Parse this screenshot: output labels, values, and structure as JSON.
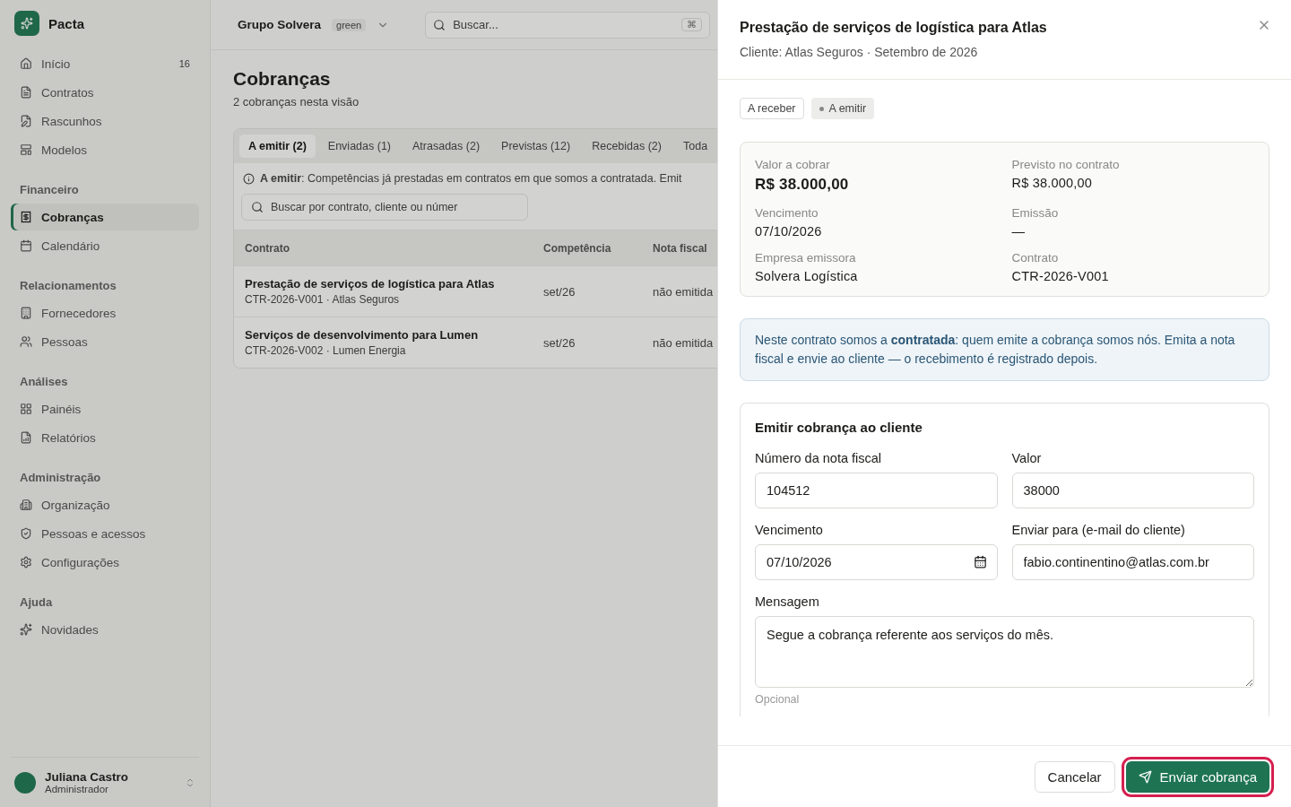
{
  "sidebar": {
    "brand": "Pacta",
    "sections": [
      {
        "items": [
          {
            "label": "Início",
            "badge": "16",
            "selected": false
          },
          {
            "label": "Contratos",
            "selected": false
          },
          {
            "label": "Rascunhos",
            "selected": false
          },
          {
            "label": "Modelos",
            "selected": false
          }
        ]
      },
      {
        "title": "Financeiro",
        "items": [
          {
            "label": "Cobranças",
            "selected": true
          },
          {
            "label": "Calendário",
            "selected": false
          }
        ]
      },
      {
        "title": "Relacionamentos",
        "items": [
          {
            "label": "Fornecedores",
            "selected": false
          },
          {
            "label": "Pessoas",
            "selected": false
          }
        ]
      },
      {
        "title": "Análises",
        "items": [
          {
            "label": "Painéis",
            "selected": false
          },
          {
            "label": "Relatórios",
            "selected": false
          }
        ]
      },
      {
        "title": "Administração",
        "items": [
          {
            "label": "Organização",
            "selected": false
          },
          {
            "label": "Pessoas e acessos",
            "selected": false
          },
          {
            "label": "Configurações",
            "selected": false
          }
        ]
      },
      {
        "title": "Ajuda",
        "items": [
          {
            "label": "Novidades",
            "selected": false
          }
        ]
      }
    ],
    "user": {
      "name": "Juliana Castro",
      "role": "Administrador"
    }
  },
  "topbar": {
    "org": "Grupo Solvera",
    "org_tag": "green",
    "search_placeholder": "Buscar...",
    "shortcut": "⌘"
  },
  "page": {
    "title": "Cobranças",
    "subtitle": "2 cobranças nesta visão",
    "tabs": [
      {
        "label": "A emitir (2)",
        "selected": true
      },
      {
        "label": "Enviadas (1)",
        "selected": false
      },
      {
        "label": "Atrasadas (2)",
        "selected": false
      },
      {
        "label": "Previstas (12)",
        "selected": false
      },
      {
        "label": "Recebidas (2)",
        "selected": false
      },
      {
        "label": "Toda",
        "selected": false
      }
    ],
    "info": "**A emitir**: Competências já prestadas em contratos em que somos a contratada. Emit",
    "filter_placeholder": "Buscar por contrato, cliente ou númer",
    "table": {
      "columns": [
        "Contrato",
        "Competência",
        "Nota fiscal"
      ],
      "rows": [
        {
          "title": "Prestação de serviços de logística para Atlas",
          "sub": "CTR-2026-V001 · Atlas Seguros",
          "period": "set/26",
          "invoice": "não emitida"
        },
        {
          "title": "Serviços de desenvolvimento para Lumen",
          "sub": "CTR-2026-V002 · Lumen Energia",
          "period": "set/26",
          "invoice": "não emitida"
        }
      ]
    }
  },
  "drawer": {
    "title": "Prestação de serviços de logística para Atlas",
    "subtitle": "Cliente: Atlas Seguros · Setembro de 2026",
    "badges": [
      {
        "label": "A receber",
        "kind": "outline"
      },
      {
        "label": "A emitir",
        "kind": "dot"
      }
    ],
    "details": [
      {
        "label": "Valor a cobrar",
        "value": "R$ 38.000,00",
        "emphasis": true
      },
      {
        "label": "Previsto no contrato",
        "value": "R$ 38.000,00",
        "emphasis": false
      },
      {
        "label": "Vencimento",
        "value": "07/10/2026",
        "emphasis": false
      },
      {
        "label": "Emissão",
        "value": "—",
        "emphasis": false
      },
      {
        "label": "Empresa emissora",
        "value": "Solvera Logística",
        "emphasis": false
      },
      {
        "label": "Contrato",
        "value": "CTR-2026-V001",
        "emphasis": false
      }
    ],
    "notice": "Neste contrato somos a **contratada**: quem emite a cobrança somos nós. Emita a nota fiscal e envie ao cliente — o recebimento é registrado depois.",
    "form": {
      "title": "Emitir cobrança ao cliente",
      "fields": [
        {
          "label": "Número da nota fiscal",
          "value": "104512",
          "kind": "text"
        },
        {
          "label": "Valor",
          "value": "38000",
          "kind": "text"
        },
        {
          "label": "Vencimento",
          "value": "07/10/2026",
          "kind": "date"
        },
        {
          "label": "Enviar para (e-mail do cliente)",
          "value": "fabio.continentino@atlas.com.br",
          "kind": "text"
        },
        {
          "label": "Mensagem",
          "value": "Segue a cobrança referente aos serviços do mês.",
          "kind": "textarea",
          "hint": "Opcional"
        }
      ]
    },
    "cancel": "Cancelar",
    "submit": "Enviar cobrança"
  }
}
